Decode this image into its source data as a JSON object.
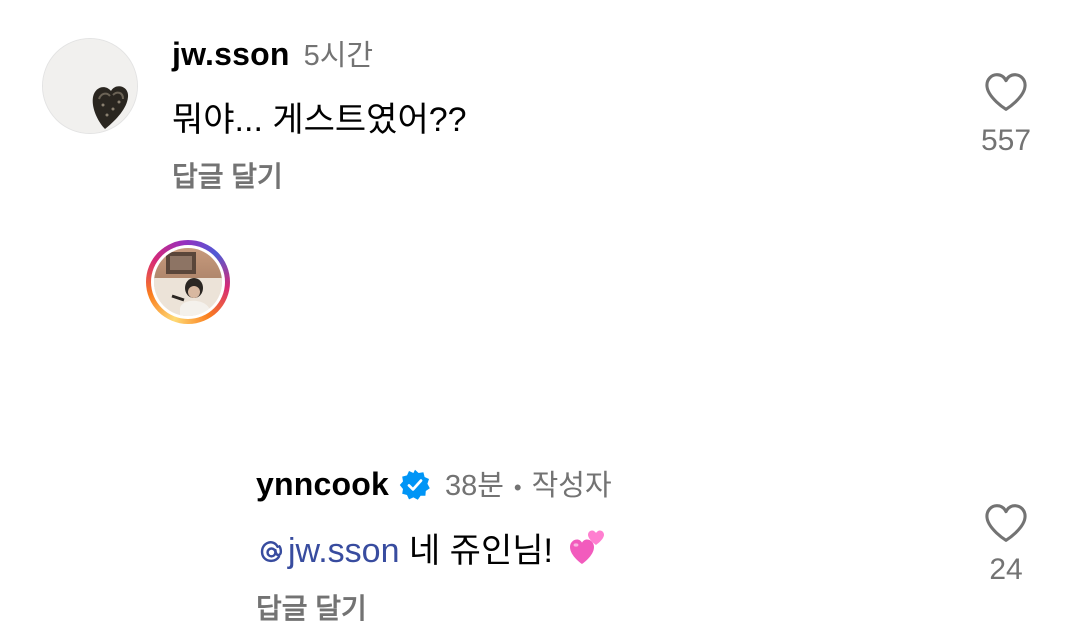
{
  "comments": [
    {
      "username": "jw.sson",
      "time": "5시간",
      "text": "뭐야... 게스트였어??",
      "reply_label": "답글 달기",
      "likes": "557",
      "icons": {
        "like": "heart-outline-icon"
      }
    },
    {
      "username": "ynncook",
      "verified": true,
      "time": "38분",
      "separator": "•",
      "author_label": "작성자",
      "mention": "jw.sson",
      "text": "네 쥬인님!",
      "emoji": "two-hearts",
      "reply_label": "답글 달기",
      "likes": "24",
      "icons": {
        "like": "heart-outline-icon",
        "mention": "threads-at-icon",
        "verified": "verified-badge-icon"
      }
    }
  ],
  "colors": {
    "secondary_text": "#737373",
    "mention": "#384c9f",
    "verified": "#0095f6"
  }
}
